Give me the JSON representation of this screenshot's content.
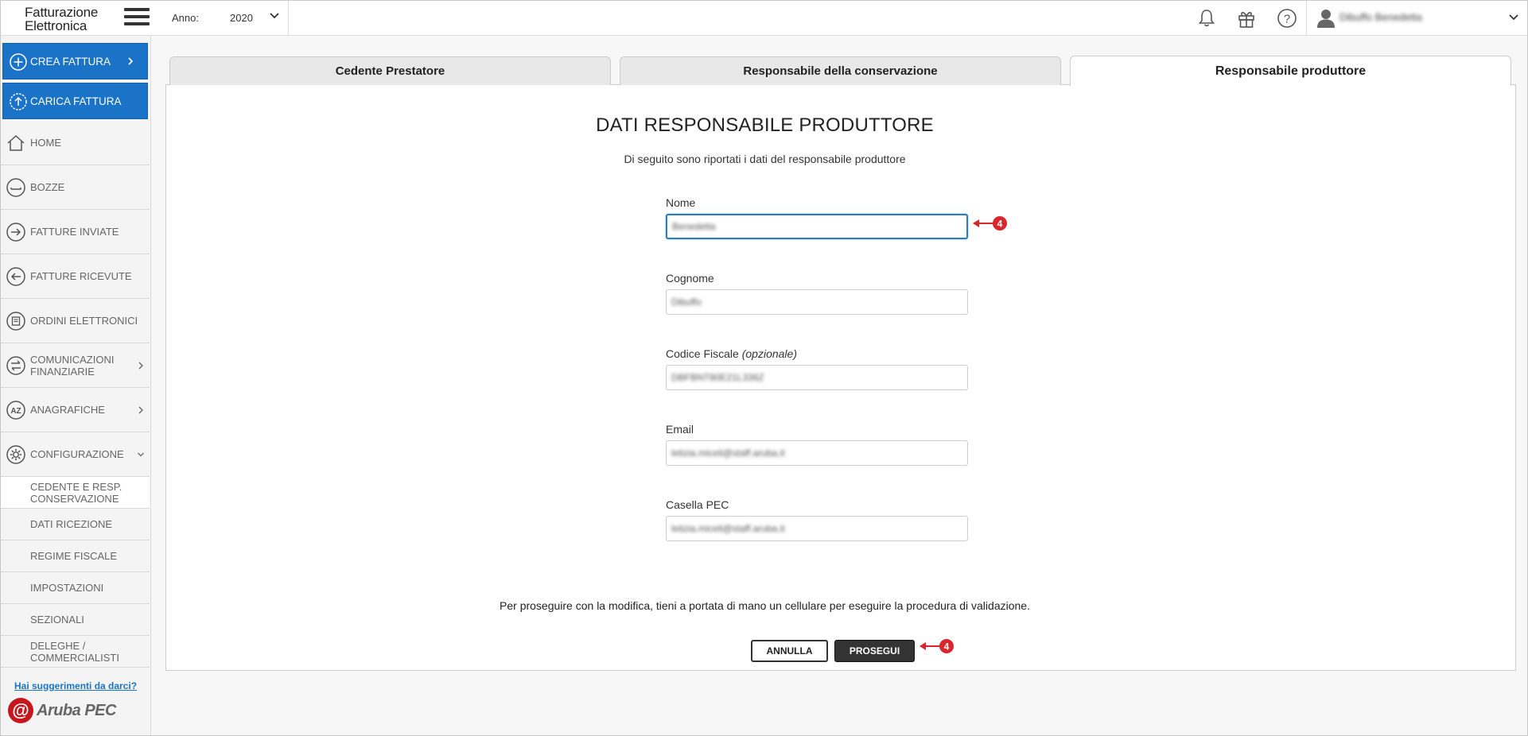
{
  "header": {
    "app_title_line1": "Fatturazione",
    "app_title_line2": "Elettronica",
    "year_label": "Anno:",
    "year_value": "2020",
    "user_name": "Dibuffo Benedetta"
  },
  "sidebar": {
    "create_invoice": "CREA FATTURA",
    "upload_invoice": "CARICA FATTURA",
    "items": [
      {
        "label": "HOME"
      },
      {
        "label": "BOZZE"
      },
      {
        "label": "FATTURE INVIATE"
      },
      {
        "label": "FATTURE RICEVUTE"
      },
      {
        "label": "ORDINI ELETTRONICI"
      },
      {
        "label": "COMUNICAZIONI FINANZIARIE"
      },
      {
        "label": "ANAGRAFICHE"
      },
      {
        "label": "CONFIGURAZIONE"
      }
    ],
    "sub_items": [
      {
        "label": "CEDENTE E RESP. CONSERVAZIONE"
      },
      {
        "label": "DATI RICEZIONE"
      },
      {
        "label": "REGIME FISCALE"
      },
      {
        "label": "IMPOSTAZIONI"
      },
      {
        "label": "SEZIONALI"
      },
      {
        "label": "DELEGHE / COMMERCIALISTI"
      }
    ],
    "suggestion_link": "Hai suggerimenti da darci?",
    "brand": "Aruba PEC"
  },
  "tabs": [
    {
      "label": "Cedente Prestatore"
    },
    {
      "label": "Responsabile della conservazione"
    },
    {
      "label": "Responsabile produttore"
    }
  ],
  "form": {
    "title": "DATI RESPONSABILE PRODUTTORE",
    "subtitle": "Di seguito sono riportati i dati del responsabile produttore",
    "name_label": "Nome",
    "name_value": "Benedetta",
    "surname_label": "Cognome",
    "surname_value": "Dibuffo",
    "tax_code_label": "Codice Fiscale",
    "tax_code_optional": "(opzionale)",
    "tax_code_value": "DBFBNT80E21L336Z",
    "email_label": "Email",
    "email_value": "letizia.miceli@staff.aruba.it",
    "pec_label": "Casella PEC",
    "pec_value": "letizia.miceli@staff.aruba.it",
    "notice": "Per proseguire con la modifica, tieni a portata di mano un cellulare per eseguire la procedura di validazione.",
    "cancel_label": "ANNULLA",
    "continue_label": "PROSEGUI"
  },
  "annotations": {
    "marker_number": "4",
    "marker_color": "#d9262b"
  },
  "colors": {
    "accent_blue": "#1a73c6",
    "dark_button": "#333333"
  }
}
